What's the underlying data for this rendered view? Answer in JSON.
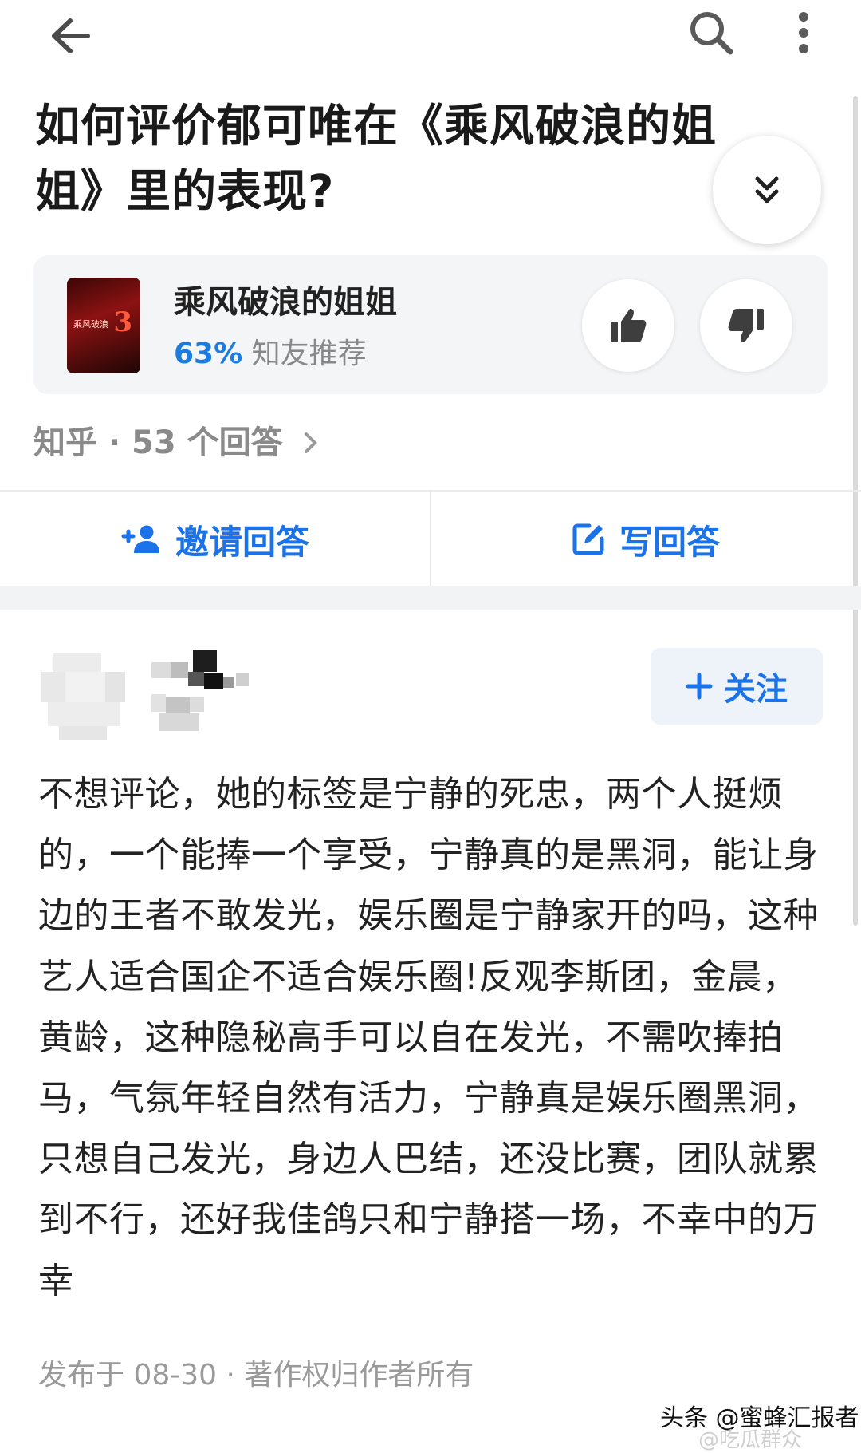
{
  "question": {
    "title": "如何评价郁可唯在《乘风破浪的姐姐》里的表现?"
  },
  "topic": {
    "name": "乘风破浪的姐姐",
    "rating_percent": "63%",
    "rating_label": "知友推荐",
    "poster_text": "乘风破浪",
    "poster_mark": "3"
  },
  "answers_meta": {
    "text": "知乎 · 53 个回答"
  },
  "actions": {
    "invite_label": "邀请回答",
    "write_label": "写回答"
  },
  "answer": {
    "follow_label": "关注",
    "body": "不想评论，她的标签是宁静的死忠，两个人挺烦的，一个能捧一个享受，宁静真的是黑洞，能让身边的王者不敢发光，娱乐圈是宁静家开的吗，这种艺人适合国企不适合娱乐圈!反观李斯团，金晨，黄龄，这种隐秘高手可以自在发光，不需吹捧拍马，气氛年轻自然有活力，宁静真是娱乐圈黑洞，只想自己发光，身边人巴结，还没比赛，团队就累到不行，还好我佳鸽只和宁静搭一场，不幸中的万幸",
    "publish_meta": "发布于 08-30 · 著作权归作者所有"
  },
  "watermark": {
    "text": "头条 @蜜蜂汇报者",
    "faint": "@吃瓜群众"
  },
  "colors": {
    "accent": "#1a73e8",
    "rating": "#1a7ce0",
    "card_bg": "#f4f5f7"
  },
  "icons": [
    "back-arrow-icon",
    "search-icon",
    "more-vertical-icon",
    "chevron-double-down-icon",
    "thumbs-up-icon",
    "thumbs-down-icon",
    "chevron-right-icon",
    "add-user-icon",
    "edit-icon",
    "plus-icon"
  ]
}
